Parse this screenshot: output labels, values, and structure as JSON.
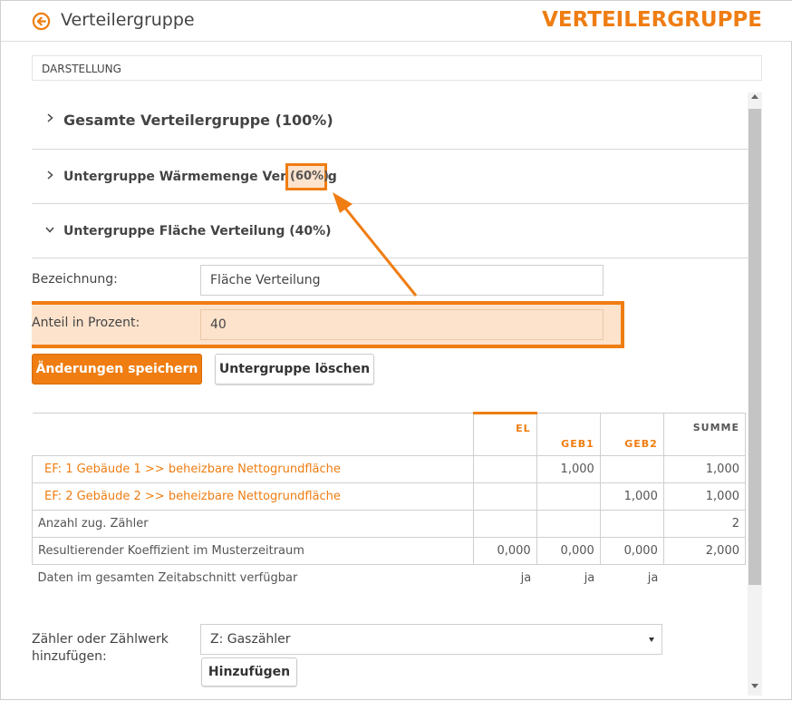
{
  "header": {
    "title": "Verteilergruppe",
    "brand_title": "VERTEILERGRUPPE",
    "back_icon": "arrow-left-circle-icon"
  },
  "section": {
    "label": "DARSTELLUNG"
  },
  "accordion": [
    {
      "title": "Gesamte Verteilergruppe (100%)",
      "expanded": false
    },
    {
      "title": "Untergruppe Wärmemenge Verteilung",
      "percent": "(60%)",
      "expanded": false
    },
    {
      "title": "Untergruppe Fläche Verteilung (40%)",
      "expanded": true
    }
  ],
  "form": {
    "bezeichnung_label": "Bezeichnung:",
    "bezeichnung_value": "Fläche Verteilung",
    "anteil_label": "Anteil in Prozent:",
    "anteil_value": "40",
    "save_label": "Änderungen speichern",
    "delete_label": "Untergruppe löschen"
  },
  "table": {
    "headers": [
      "EL",
      "GEB1",
      "GEB2",
      "SUMME"
    ],
    "rows": [
      {
        "label": "EF: 1 Gebäude 1 >> beheizbare Nettogrundfläche",
        "values": [
          "",
          "1,000",
          "",
          "1,000"
        ]
      },
      {
        "label": "EF: 2 Gebäude 2 >> beheizbare Nettogrundfläche",
        "values": [
          "",
          "",
          "1,000",
          "1,000"
        ]
      },
      {
        "label": "Anzahl zug. Zähler",
        "values": [
          "",
          "",
          "",
          "2"
        ]
      },
      {
        "label": "Resultierender Koeffizient im Musterzeitraum",
        "values": [
          "0,000",
          "0,000",
          "0,000",
          "2,000"
        ]
      },
      {
        "label": "Daten im gesamten Zeitabschnitt verfügbar",
        "values": [
          "ja",
          "ja",
          "ja",
          ""
        ]
      }
    ]
  },
  "add": {
    "label_line1": "Zähler oder Zählwerk",
    "label_line2": "hinzufügen:",
    "select_value": "Z: Gaszähler",
    "button_label": "Hinzufügen"
  },
  "colors": {
    "accent": "#ef7d12",
    "highlight_fill": "#fde3cc"
  }
}
